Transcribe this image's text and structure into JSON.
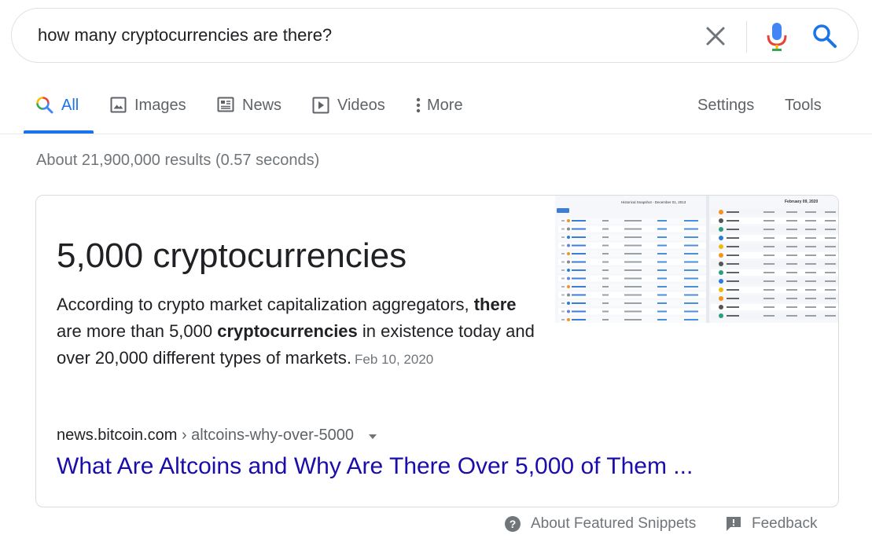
{
  "search": {
    "query": "how many cryptocurrencies are there?",
    "icons": {
      "clear": "close-icon",
      "mic": "microphone-icon",
      "search": "search-icon"
    }
  },
  "tabs": [
    {
      "label": "All",
      "icon": "search-icon",
      "active": true
    },
    {
      "label": "Images",
      "icon": "image-icon"
    },
    {
      "label": "News",
      "icon": "newspaper-icon"
    },
    {
      "label": "Videos",
      "icon": "play-icon"
    },
    {
      "label": "More",
      "icon": "more-vert-icon"
    },
    {
      "label": "Settings"
    },
    {
      "label": "Tools"
    }
  ],
  "result_stats": "About 21,900,000 results (0.57 seconds)",
  "snippet": {
    "answer": "5,000 cryptocurrencies",
    "text_parts": [
      "According to crypto market capitalization aggregators, ",
      "there",
      " are more than 5,000 ",
      "cryptocurrencies",
      " in existence today and over 20,000 different types of markets."
    ],
    "date": "Feb 10, 2020",
    "thumbnail": {
      "left_header": "Historical Snapshot - December 01, 2013",
      "right_header": "February 09, 2020"
    },
    "cite_domain": "news.bitcoin.com",
    "cite_path": " › altcoins-why-over-5000",
    "title": "What Are Altcoins and Why Are There Over 5,000 of Them ..."
  },
  "footer": {
    "about_label": "About Featured Snippets",
    "feedback_label": "Feedback"
  },
  "colors": {
    "link": "#1a0dab",
    "accent": "#1a73e8",
    "muted": "#70757a"
  }
}
